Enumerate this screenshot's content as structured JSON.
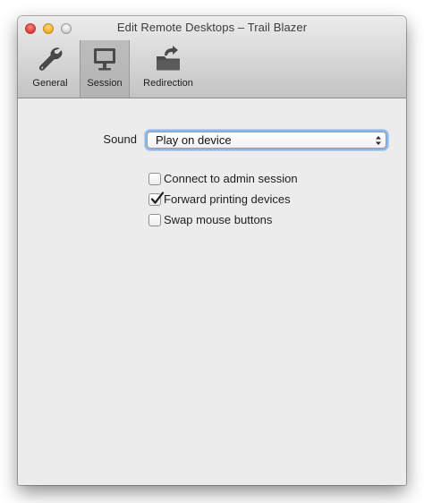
{
  "window": {
    "title": "Edit Remote Desktops – Trail Blazer"
  },
  "toolbar": {
    "tabs": [
      {
        "label": "General",
        "icon": "wrench-icon",
        "selected": false
      },
      {
        "label": "Session",
        "icon": "monitor-icon",
        "selected": true
      },
      {
        "label": "Redirection",
        "icon": "folder-redirect-icon",
        "selected": false
      }
    ]
  },
  "session": {
    "sound_label": "Sound",
    "sound_value": "Play on device",
    "options": [
      {
        "label": "Connect to admin session",
        "checked": false
      },
      {
        "label": "Forward printing devices",
        "checked": true
      },
      {
        "label": "Swap mouse buttons",
        "checked": false
      }
    ]
  },
  "colors": {
    "focus_ring": "#8cb7ed",
    "window_background": "#ececec"
  }
}
